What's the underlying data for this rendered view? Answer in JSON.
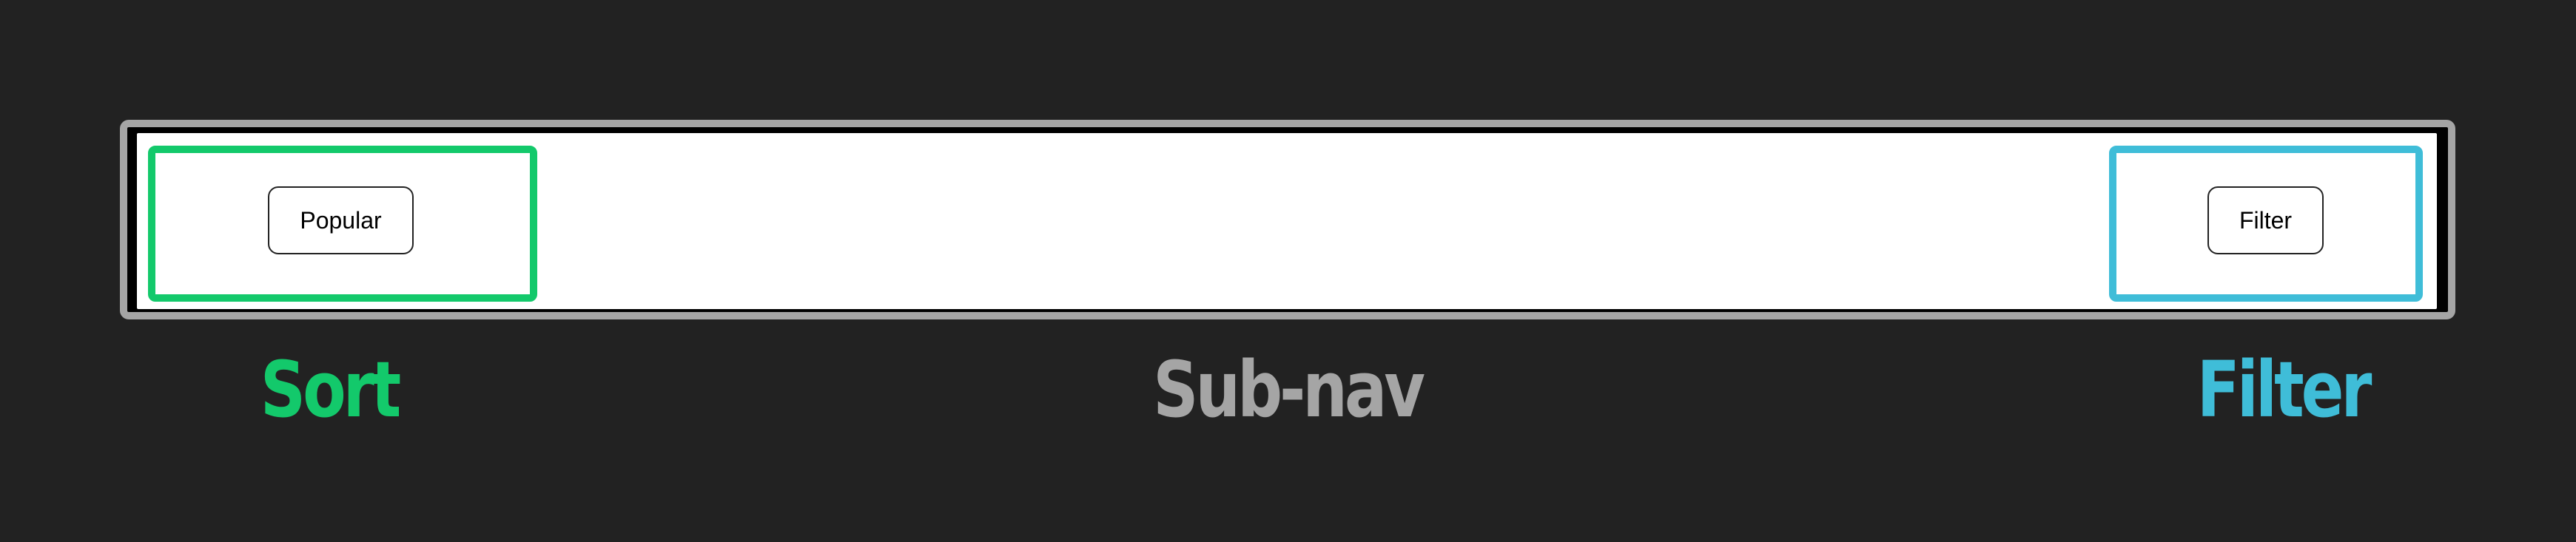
{
  "colors": {
    "background": "#222222",
    "subnav": "#a5a5a5",
    "sort": "#13c96b",
    "filter": "#3fbdd8"
  },
  "subnav": {
    "label": "Sub-nav"
  },
  "sort": {
    "label": "Sort",
    "button_label": "Popular"
  },
  "filter": {
    "label": "Filter",
    "button_label": "Filter"
  }
}
